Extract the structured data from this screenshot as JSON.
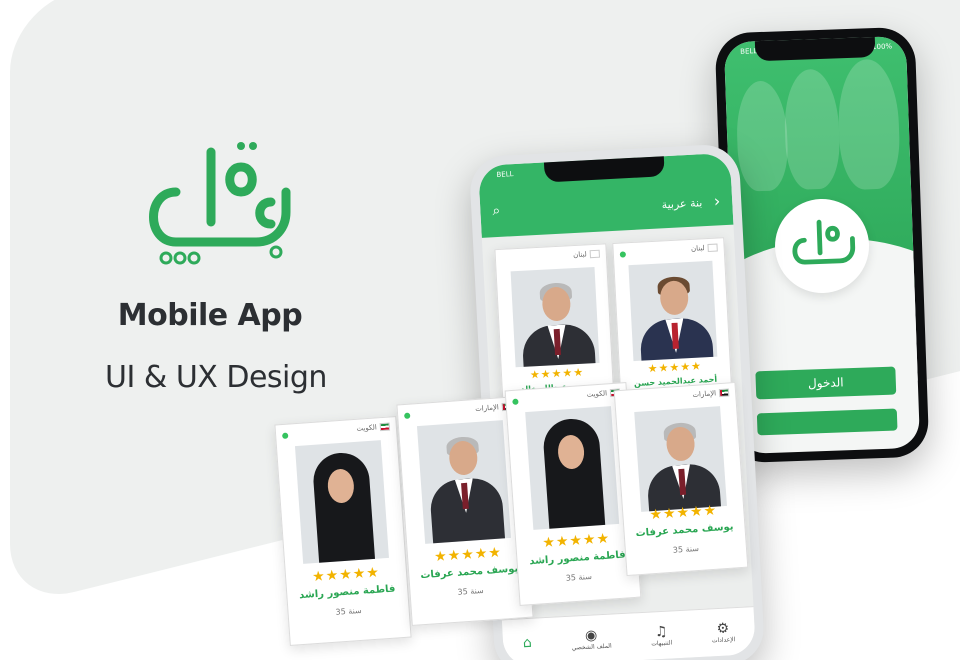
{
  "brand": {
    "title": "Mobile App",
    "subtitle": "UI & UX Design",
    "colors": {
      "primary": "#2eaa5a",
      "star": "#f2b300",
      "text": "#2c2f33"
    }
  },
  "login_screen": {
    "carrier": "BELL",
    "battery": "100%",
    "login_button": "الدخول"
  },
  "list_screen": {
    "carrier": "BELL",
    "header_title": "بنة عربية",
    "search_icon": "search-icon",
    "back_icon": "chevron-right-icon",
    "nav": [
      {
        "label": "",
        "icon": "home-icon"
      },
      {
        "label": "الملف الشخصي",
        "icon": "user-icon"
      },
      {
        "label": "التنبيهات",
        "icon": "bell-icon"
      },
      {
        "label": "الإعدادات",
        "icon": "gear-icon"
      }
    ]
  },
  "phone_cards": [
    {
      "country": "لبنان",
      "stars": "★★★★★",
      "name": "محمود عبدالله خالد"
    },
    {
      "country": "لبنان",
      "stars": "★★★★★",
      "name": "أحمد عبدالحميد حسن"
    }
  ],
  "floating_cards": [
    {
      "country": "الكويت",
      "flag": "kw",
      "stars": "★★★★★",
      "name": "فاطمة منصور راشد",
      "age": "35 سنة",
      "photo": "woman"
    },
    {
      "country": "الإمارات",
      "flag": "ae",
      "stars": "★★★★★",
      "name": "يوسف محمد عرفات",
      "age": "35 سنة",
      "photo": "man"
    },
    {
      "country": "الكويت",
      "flag": "kw",
      "stars": "★★★★★",
      "name": "فاطمة منصور راشد",
      "age": "35 سنة",
      "photo": "woman"
    },
    {
      "country": "الإمارات",
      "flag": "ae",
      "stars": "★★★★★",
      "name": "يوسف محمد عرفات",
      "age": "35 سنة",
      "photo": "man"
    }
  ]
}
